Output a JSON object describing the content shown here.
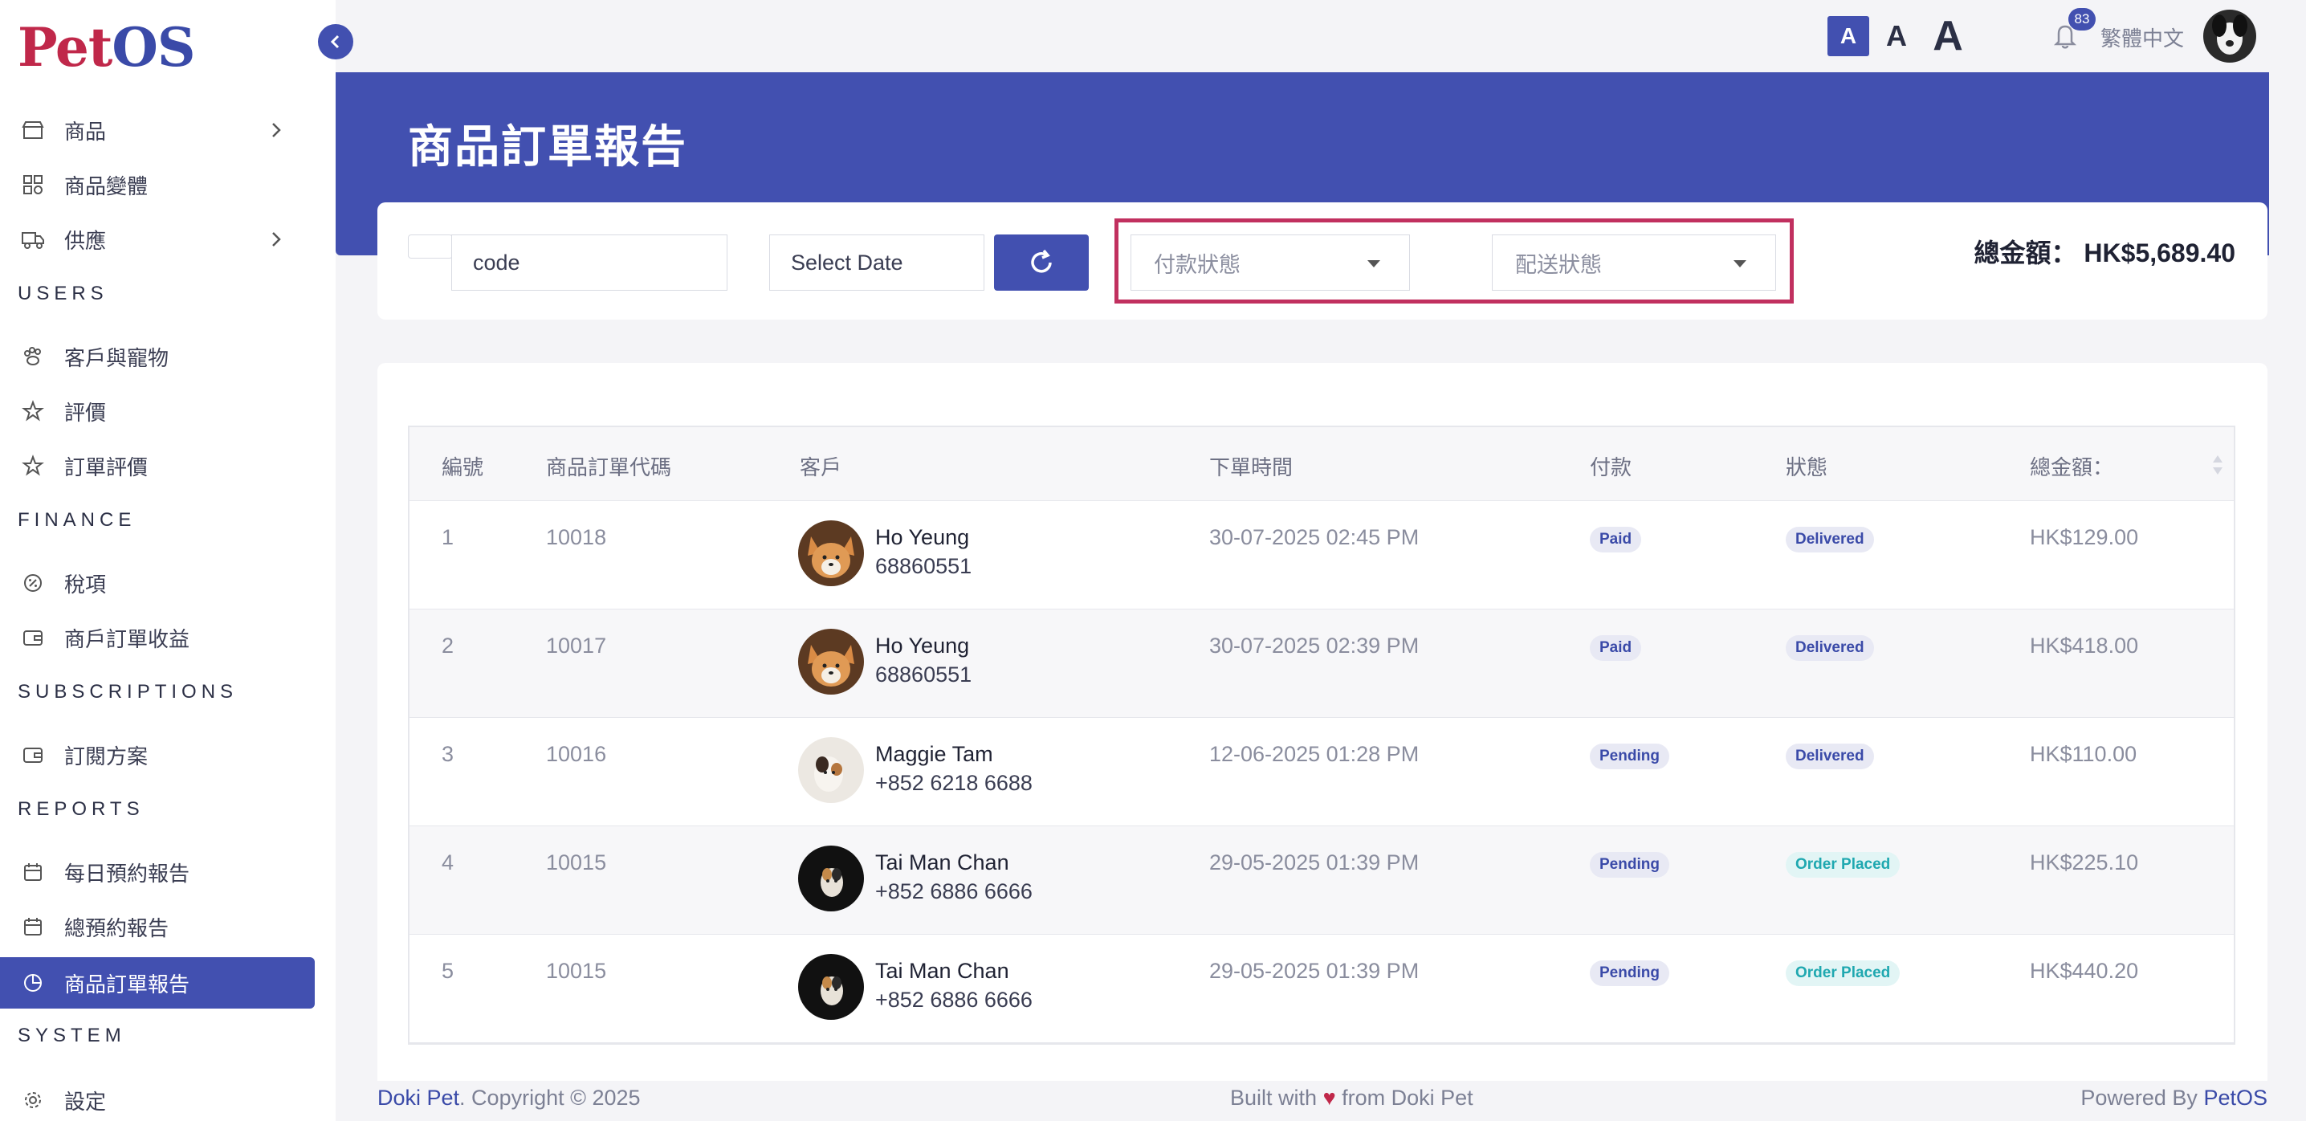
{
  "logo": {
    "part1": "Pet",
    "part2": "OS"
  },
  "sidebar": {
    "items": [
      {
        "label": "商品"
      },
      {
        "label": "商品變體"
      },
      {
        "label": "供應"
      },
      {
        "label": "客戶與寵物"
      },
      {
        "label": "評價"
      },
      {
        "label": "訂單評價"
      },
      {
        "label": "稅項"
      },
      {
        "label": "商戶訂單收益"
      },
      {
        "label": "訂閱方案"
      },
      {
        "label": "每日預約報告"
      },
      {
        "label": "總預約報告"
      },
      {
        "label": "商品訂單報告"
      },
      {
        "label": "設定"
      }
    ],
    "sections": [
      "USERS",
      "FINANCE",
      "SUBSCRIPTIONS",
      "REPORTS",
      "SYSTEM"
    ]
  },
  "topbar": {
    "font_small": "A",
    "font_medium": "A",
    "font_large": "A",
    "notification_count": "83",
    "language": "繁體中文"
  },
  "page": {
    "title": "商品訂單報告"
  },
  "filters": {
    "code_value": "code",
    "date_placeholder": "Select Date",
    "payment_status_placeholder": "付款狀態",
    "delivery_status_placeholder": "配送狀態",
    "total_label": "總金額：",
    "total_value": "HK$5,689.40"
  },
  "table": {
    "headers": [
      "編號",
      "商品訂單代碼",
      "客戶",
      "下單時間",
      "付款",
      "狀態",
      "總金額："
    ],
    "rows": [
      {
        "no": "1",
        "code": "10018",
        "name": "Ho Yeung",
        "phone": "68860551",
        "time": "30-07-2025 02:45 PM",
        "payment": "Paid",
        "status": "Delivered",
        "amount": "HK$129.00"
      },
      {
        "no": "2",
        "code": "10017",
        "name": "Ho Yeung",
        "phone": "68860551",
        "time": "30-07-2025 02:39 PM",
        "payment": "Paid",
        "status": "Delivered",
        "amount": "HK$418.00"
      },
      {
        "no": "3",
        "code": "10016",
        "name": "Maggie Tam",
        "phone": "+852 6218 6688",
        "time": "12-06-2025 01:28 PM",
        "payment": "Pending",
        "status": "Delivered",
        "amount": "HK$110.00"
      },
      {
        "no": "4",
        "code": "10015",
        "name": "Tai Man Chan",
        "phone": "+852 6886 6666",
        "time": "29-05-2025 01:39 PM",
        "payment": "Pending",
        "status": "Order Placed",
        "amount": "HK$225.10"
      },
      {
        "no": "5",
        "code": "10015",
        "name": "Tai Man Chan",
        "phone": "+852 6886 6666",
        "time": "29-05-2025 01:39 PM",
        "payment": "Pending",
        "status": "Order Placed",
        "amount": "HK$440.20"
      }
    ]
  },
  "footer": {
    "left_brand": "Doki Pet",
    "left_text": ". Copyright © 2025",
    "center_pre": "Built with",
    "center_heart": "♥",
    "center_post": "from Doki Pet",
    "right_text": "Powered By",
    "right_brand": "PetOS"
  },
  "colors": {
    "accent": "#4250b0",
    "brand_red": "#c0284a",
    "highlight": "#c1305f",
    "teal": "#1fa8b0"
  }
}
